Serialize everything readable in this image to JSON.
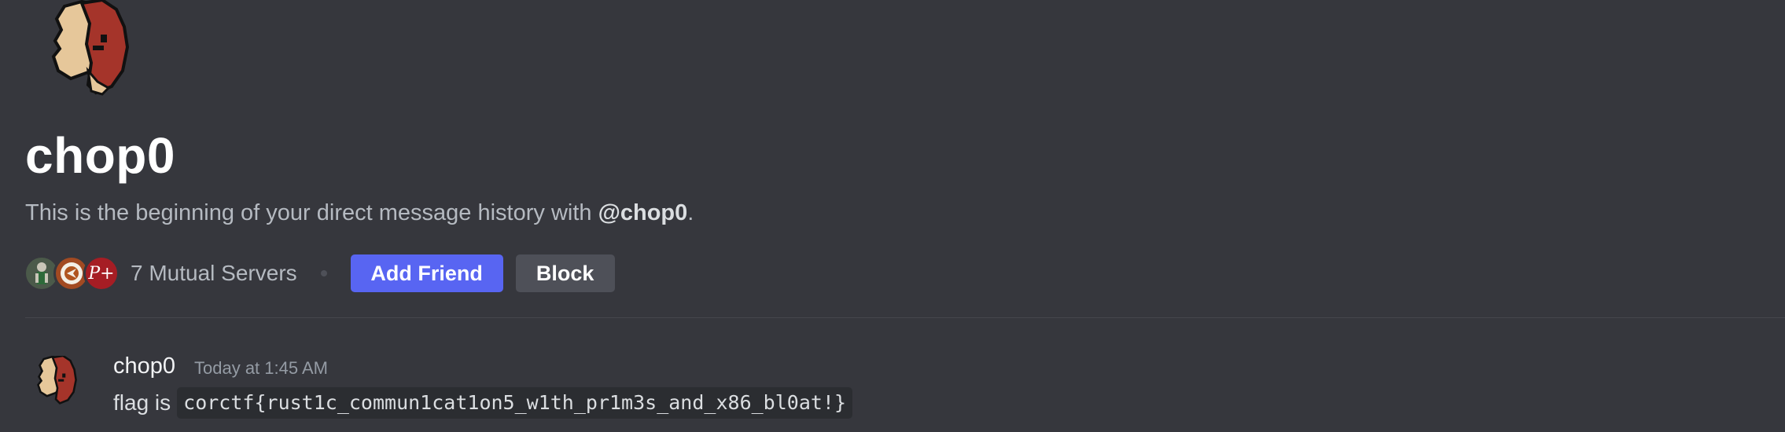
{
  "profile": {
    "name": "chop0",
    "intro_prefix": "This is the beginning of your direct message history with ",
    "intro_handle": "@chop0",
    "intro_suffix": "."
  },
  "mutual": {
    "label": "7 Mutual Servers",
    "servers": [
      "server-icon-soldier",
      "server-icon-crest",
      "server-icon-pplus"
    ],
    "pplus_glyph": "P+"
  },
  "actions": {
    "add_friend_label": "Add Friend",
    "block_label": "Block"
  },
  "message": {
    "author": "chop0",
    "timestamp": "Today at 1:45 AM",
    "text": "flag is",
    "code": "corctf{rust1c_commun1cat1on5_w1th_pr1m3s_and_x86_bl0at!}"
  },
  "colors": {
    "background": "#36373d",
    "accent": "#5865f2",
    "secondary_button": "#4e5058"
  }
}
